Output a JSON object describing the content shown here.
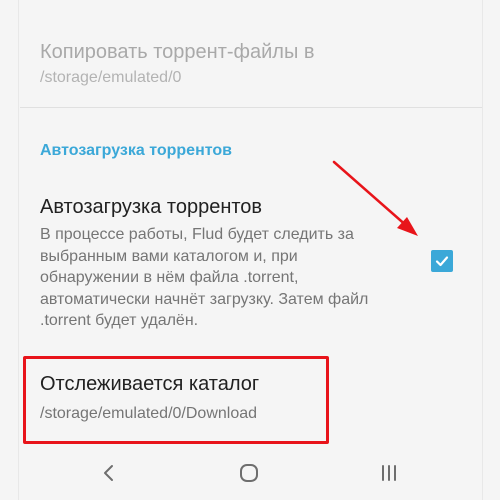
{
  "preferences": {
    "copy_torrents": {
      "title": "Копировать торрент-файлы в",
      "summary": "/storage/emulated/0",
      "enabled": false
    },
    "category": {
      "label": "Автозагрузка торрентов"
    },
    "auto_load": {
      "title": "Автозагрузка торрентов",
      "summary": "В процессе работы, Flud будет следить за выбранным вами каталогом и, при обнаружении в нём файла .torrent, автоматически начнёт загрузку. Затем файл .torrent будет удалён.",
      "checked": true
    },
    "watched_folder": {
      "title": "Отслеживается каталог",
      "summary": "/storage/emulated/0/Download"
    }
  },
  "navbar": {
    "back_icon": "back-chevron-icon",
    "home_icon": "home-circle-icon",
    "recents_icon": "recents-bars-icon"
  },
  "colors": {
    "accent": "#3ba8d8",
    "annotation": "#e8141a",
    "background": "#f5f5f5"
  }
}
